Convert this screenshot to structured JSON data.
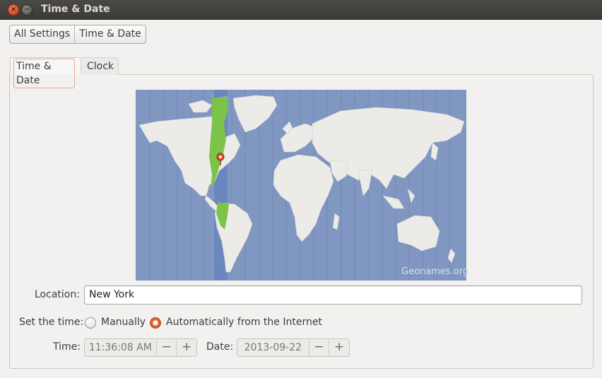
{
  "window": {
    "title": "Time & Date"
  },
  "breadcrumb": {
    "items": [
      "All Settings",
      "Time & Date"
    ]
  },
  "tabs": [
    {
      "label": "Time & Date",
      "active": true
    },
    {
      "label": "Clock",
      "active": false
    }
  ],
  "map": {
    "credit": "Geonames.org",
    "selected_city": "New York"
  },
  "location": {
    "label": "Location:",
    "value": "New York"
  },
  "set_time": {
    "label": "Set the time:",
    "options": [
      {
        "label": "Manually",
        "selected": false
      },
      {
        "label": "Automatically from the Internet",
        "selected": true
      }
    ]
  },
  "time": {
    "label": "Time:",
    "value": "11:36:08 AM",
    "minus": "−",
    "plus": "+"
  },
  "date": {
    "label": "Date:",
    "value": "2013-09-22",
    "minus": "−",
    "plus": "+"
  },
  "colors": {
    "ocean": "#7f97c1",
    "land": "#ececea",
    "selected_zone": "#7fc54a",
    "accent": "#dd4814"
  },
  "icons": {
    "close": "close-icon",
    "minimize": "minimize-icon",
    "pin": "map-pin-icon"
  }
}
